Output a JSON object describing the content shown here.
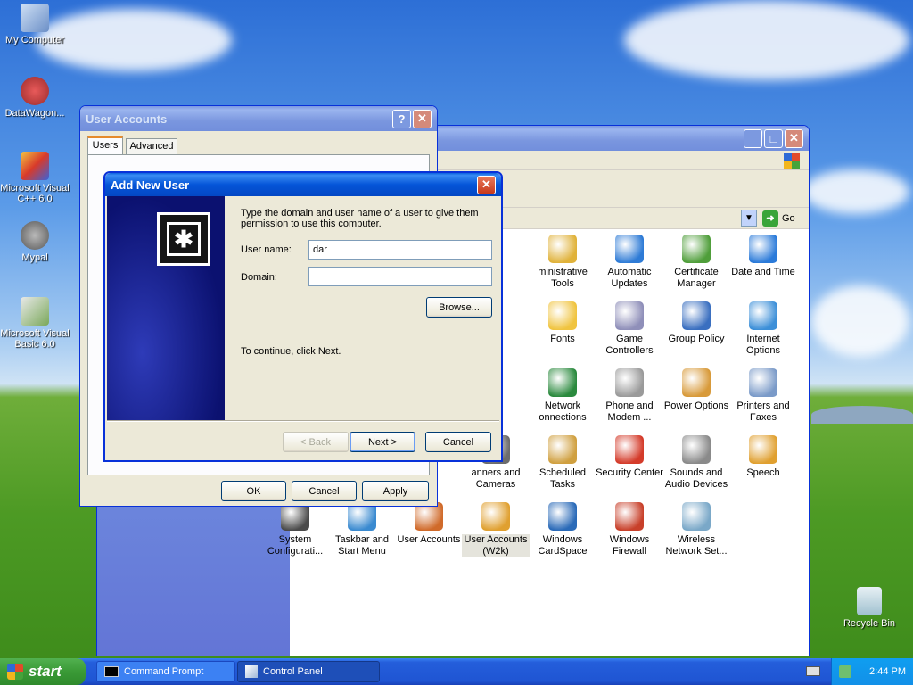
{
  "desktop": {
    "icons": [
      {
        "label": "My Computer"
      },
      {
        "label": "DataWagon..."
      },
      {
        "label": "Microsoft Visual C++ 6.0"
      },
      {
        "label": "Mypal"
      },
      {
        "label": "Microsoft Visual Basic 6.0"
      },
      {
        "label": "Recycle Bin"
      }
    ]
  },
  "control_panel": {
    "go_label": "Go",
    "items": [
      {
        "label": "Administrative Tools",
        "display": "ministrative\nTools"
      },
      {
        "label": "Automatic Updates"
      },
      {
        "label": "Certificate Manager"
      },
      {
        "label": "Date and Time"
      },
      {
        "label": "Fonts"
      },
      {
        "label": "Game Controllers"
      },
      {
        "label": "Group Policy"
      },
      {
        "label": "Internet Options"
      },
      {
        "label": "Network Connections",
        "display": "Network\nonnections"
      },
      {
        "label": "Phone and Modem ..."
      },
      {
        "label": "Power Options"
      },
      {
        "label": "Printers and Faxes"
      },
      {
        "label": "Scanners and Cameras",
        "display": "anners and\nCameras"
      },
      {
        "label": "Scheduled Tasks"
      },
      {
        "label": "Security Center"
      },
      {
        "label": "Sounds and Audio Devices"
      },
      {
        "label": "Speech"
      },
      {
        "label": "System Configurati..."
      },
      {
        "label": "Taskbar and Start Menu"
      },
      {
        "label": "User Accounts"
      },
      {
        "label": "User Accounts (W2k)"
      },
      {
        "label": "Windows CardSpace"
      },
      {
        "label": "Windows Firewall"
      },
      {
        "label": "Wireless Network Set..."
      }
    ]
  },
  "user_accounts": {
    "title": "User Accounts",
    "tabs": [
      "Users",
      "Advanced"
    ],
    "ok": "OK",
    "cancel": "Cancel",
    "apply": "Apply"
  },
  "add_user": {
    "title": "Add New User",
    "instruction": "Type the domain and user name of a user to give them permission to use this computer.",
    "username_label": "User name:",
    "username_value": "dar",
    "domain_label": "Domain:",
    "domain_value": "",
    "browse": "Browse...",
    "continue_text": "To continue, click Next.",
    "back": "< Back",
    "next": "Next >",
    "cancel": "Cancel"
  },
  "taskbar": {
    "start": "start",
    "tasks": [
      {
        "label": "Command Prompt"
      },
      {
        "label": "Control Panel"
      }
    ],
    "clock": "2:44 PM"
  },
  "colors": {
    "title_active": "#0555d8",
    "taskbar": "#245edb",
    "start_green": "#3a9a36"
  }
}
